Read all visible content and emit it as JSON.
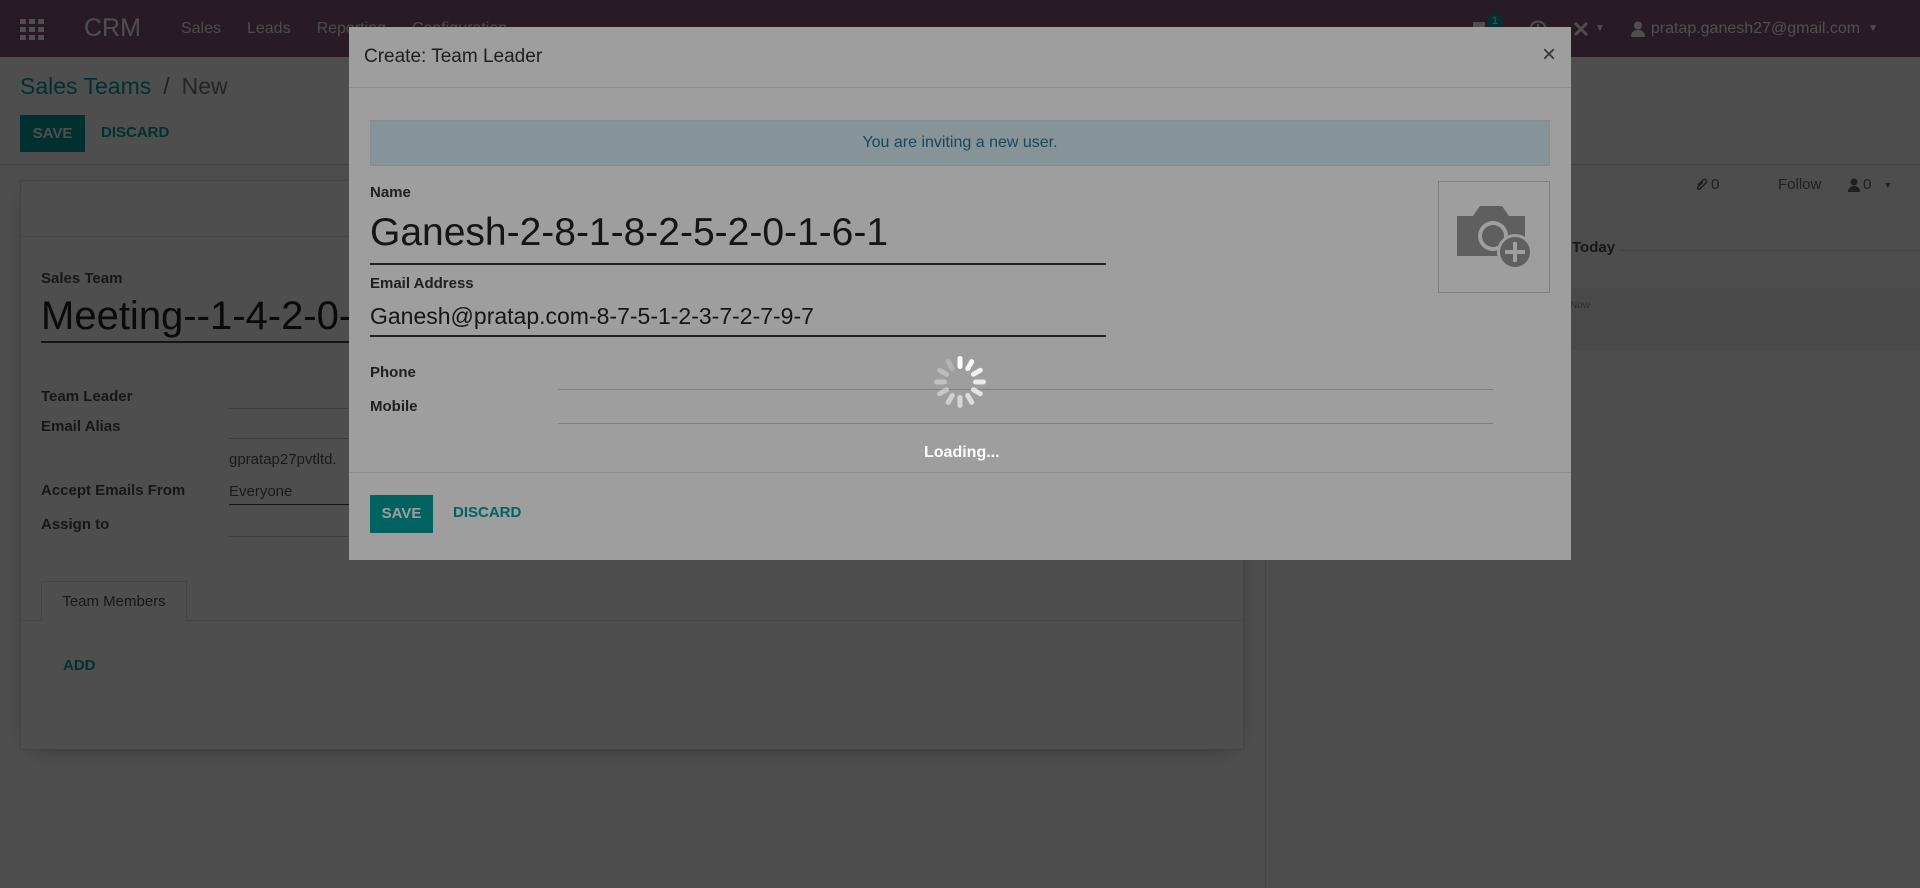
{
  "navbar": {
    "brand": "CRM",
    "menu": [
      "Sales",
      "Leads",
      "Reporting",
      "Configuration"
    ],
    "message_badge": "1",
    "user_email": "pratap.ganesh27@gmail.com"
  },
  "control_panel": {
    "breadcrumb_parent": "Sales Teams",
    "breadcrumb_separator": "/",
    "breadcrumb_current": "New",
    "save_label": "SAVE",
    "discard_label": "DISCARD"
  },
  "form": {
    "sales_team_label": "Sales Team",
    "sales_team_value": "Meeting--1-4-2-0-1",
    "team_leader_label": "Team Leader",
    "email_alias_label": "Email Alias",
    "email_alias_value": "gpratap27pvtltd.",
    "accept_emails_label": "Accept Emails From",
    "accept_emails_value": "Everyone",
    "assign_to_label": "Assign to",
    "tab_team_members": "Team Members",
    "add_label": "ADD"
  },
  "chatter": {
    "attachments_count": "0",
    "follow_label": "Follow",
    "followers_count": "0",
    "today_label": "Today",
    "message_stub": "Now"
  },
  "modal": {
    "title": "Create: Team Leader",
    "close_glyph": "×",
    "alert_text": "You are inviting a new user.",
    "name_label": "Name",
    "name_value": "Ganesh-2-8-1-8-2-5-2-0-1-6-1",
    "email_label": "Email Address",
    "email_value": "Ganesh@pratap.com-8-7-5-1-2-3-7-2-7-9-7",
    "phone_label": "Phone",
    "mobile_label": "Mobile",
    "save_label": "SAVE",
    "discard_label": "DISCARD"
  },
  "loading": {
    "text": "Loading..."
  },
  "colors": {
    "navbar": "#875a7b",
    "accent": "#00a09d",
    "alert_bg": "#d9edf7"
  }
}
